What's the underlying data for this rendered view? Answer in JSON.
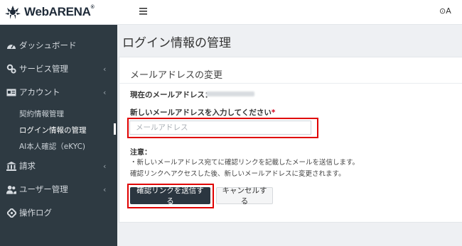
{
  "brand": {
    "name": "WebARENA",
    "reg": "®"
  },
  "header": {
    "menu_icon": "hamburger-icon",
    "user_label": "⊙A"
  },
  "sidebar": {
    "items": [
      {
        "icon": "dashboard-icon",
        "label": "ダッシュボード",
        "has_chevron": false
      },
      {
        "icon": "services-icon",
        "label": "サービス管理",
        "has_chevron": true
      },
      {
        "icon": "account-card-icon",
        "label": "アカウント",
        "has_chevron": true
      },
      {
        "icon": "bank-icon",
        "label": "請求",
        "has_chevron": true
      },
      {
        "icon": "users-icon",
        "label": "ユーザー管理",
        "has_chevron": true
      },
      {
        "icon": "diamond-icon",
        "label": "操作ログ",
        "has_chevron": false
      }
    ],
    "chevron": "‹",
    "account_sub": [
      {
        "label": "契約情報管理",
        "active": false
      },
      {
        "label": "ログイン情報の管理",
        "active": true
      },
      {
        "label": "AI本人確認（eKYC)",
        "active": false
      }
    ]
  },
  "page": {
    "title": "ログイン情報の管理"
  },
  "card": {
    "title": "メールアドレスの変更",
    "current_label": "現在のメールアドレス：",
    "new_label": "新しいメールアドレスを入力してください",
    "required_mark": "*",
    "input_placeholder": "メールアドレス",
    "input_value": "",
    "note_title": "注意：",
    "note_lines": [
      "・新しいメールアドレス宛てに確認リンクを記載したメールを送信します。",
      "確認リンクへアクセスした後、新しいメールアドレスに変更されます。"
    ],
    "send_button": "確認リンクを送信する",
    "cancel_button": "キャンセルする"
  },
  "colors": {
    "sidebar_bg": "#2e3a42",
    "primary_button": "#2b3640",
    "highlight": "#e00000",
    "required": "#d0021b"
  }
}
